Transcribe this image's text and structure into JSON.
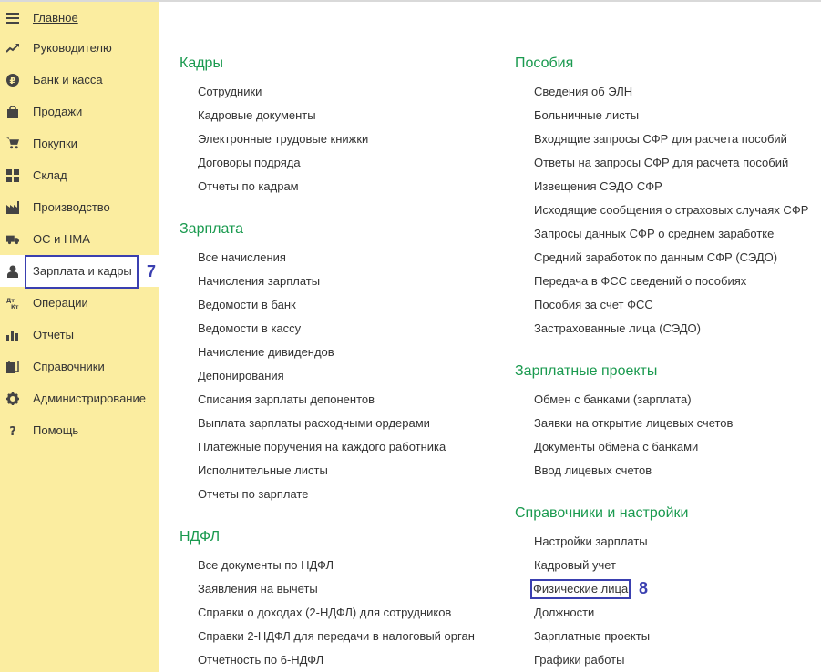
{
  "sidebar": {
    "items": [
      {
        "label": "Главное",
        "icon": "menu-icon"
      },
      {
        "label": "Руководителю",
        "icon": "trend-icon"
      },
      {
        "label": "Банк и касса",
        "icon": "ruble-icon"
      },
      {
        "label": "Продажи",
        "icon": "bag-icon"
      },
      {
        "label": "Покупки",
        "icon": "cart-icon"
      },
      {
        "label": "Склад",
        "icon": "grid-icon"
      },
      {
        "label": "Производство",
        "icon": "factory-icon"
      },
      {
        "label": "ОС и НМА",
        "icon": "truck-icon"
      },
      {
        "label": "Зарплата и кадры",
        "icon": "person-icon"
      },
      {
        "label": "Операции",
        "icon": "dt-kt-icon"
      },
      {
        "label": "Отчеты",
        "icon": "bar-chart-icon"
      },
      {
        "label": "Справочники",
        "icon": "book-icon"
      },
      {
        "label": "Администрирование",
        "icon": "gear-icon"
      },
      {
        "label": "Помощь",
        "icon": "question-icon"
      }
    ],
    "active_marker": "7"
  },
  "sections": {
    "kadry": {
      "title": "Кадры",
      "links": [
        "Сотрудники",
        "Кадровые документы",
        "Электронные трудовые книжки",
        "Договоры подряда",
        "Отчеты по кадрам"
      ]
    },
    "zarplata": {
      "title": "Зарплата",
      "links": [
        "Все начисления",
        "Начисления зарплаты",
        "Ведомости в банк",
        "Ведомости в кассу",
        "Начисление дивидендов",
        "Депонирования",
        "Списания зарплаты депонентов",
        "Выплата зарплаты расходными ордерами",
        "Платежные поручения на каждого работника",
        "Исполнительные листы",
        "Отчеты по зарплате"
      ]
    },
    "ndfl": {
      "title": "НДФЛ",
      "links": [
        "Все документы по НДФЛ",
        "Заявления на вычеты",
        "Справки о доходах (2-НДФЛ) для сотрудников",
        "Справки 2-НДФЛ для передачи в налоговый орган",
        "Отчетность по 6-НДФЛ"
      ]
    },
    "posobiya": {
      "title": "Пособия",
      "links": [
        "Сведения об ЭЛН",
        "Больничные листы",
        "Входящие запросы СФР для расчета пособий",
        "Ответы на запросы СФР для расчета пособий",
        "Извещения СЭДО СФР",
        "Исходящие сообщения о страховых случаях СФР",
        "Запросы данных СФР о среднем заработке",
        "Средний заработок по данным СФР (СЭДО)",
        "Передача в ФСС сведений о пособиях",
        "Пособия за счет ФСС",
        "Застрахованные лица (СЭДО)"
      ]
    },
    "zp_projects": {
      "title": "Зарплатные проекты",
      "links": [
        "Обмен с банками (зарплата)",
        "Заявки на открытие лицевых счетов",
        "Документы обмена с банками",
        "Ввод лицевых счетов"
      ]
    },
    "settings": {
      "title": "Справочники и настройки",
      "links": [
        "Настройки зарплаты",
        "Кадровый учет",
        "Физические лица",
        "Должности",
        "Зарплатные проекты",
        "Графики работы"
      ],
      "marker": "8"
    }
  },
  "colors": {
    "sidebar_bg": "#fbeda0",
    "section_title": "#1a9a4f",
    "highlight": "#3a3fb0"
  }
}
